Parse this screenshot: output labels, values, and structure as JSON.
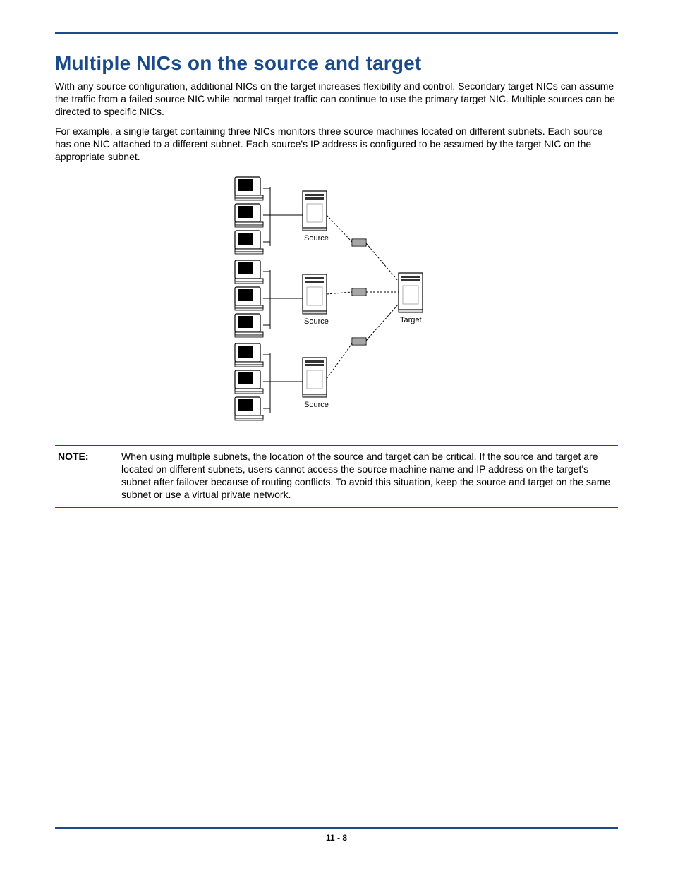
{
  "heading": "Multiple NICs on the source and target",
  "para1": "With any source configuration, additional NICs on the target increases flexibility and control. Secondary target NICs can assume the traffic from a failed source NIC while normal target traffic can continue to use the primary target NIC. Multiple sources can be directed to specific NICs.",
  "para2": "For example, a single target containing three NICs monitors three source machines located on different subnets. Each source has one NIC attached to a different subnet. Each source's IP address is configured to be assumed by the target NIC on the appropriate subnet.",
  "diagram": {
    "source_label": "Source",
    "target_label": "Target"
  },
  "note": {
    "label": "NOTE:",
    "body": "When using multiple subnets, the location of the source and target can be critical. If the source and target are located on different subnets, users cannot access the source machine name and IP address on the target's subnet after failover because of routing conflicts. To avoid this situation, keep the source and target on the same subnet or use a virtual private network."
  },
  "footer": "11 - 8"
}
